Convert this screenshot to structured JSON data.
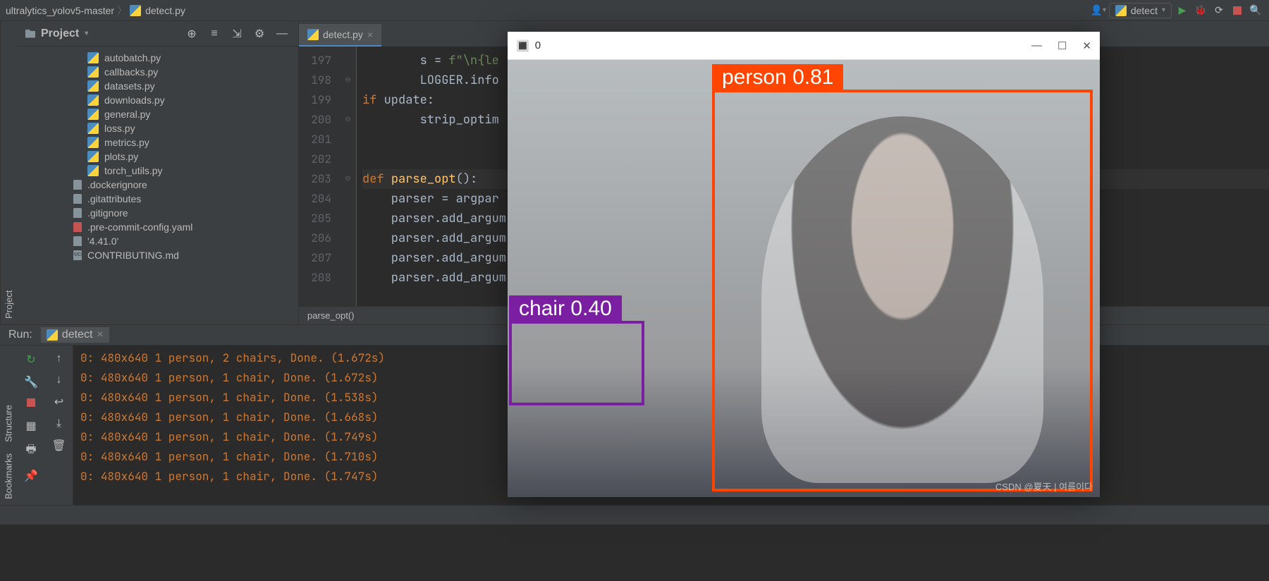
{
  "nav": {
    "breadcrumb_root": "ultralytics_yolov5-master",
    "breadcrumb_file": "detect.py",
    "run_config": "detect"
  },
  "project": {
    "title": "Project",
    "files": [
      "autobatch.py",
      "callbacks.py",
      "datasets.py",
      "downloads.py",
      "general.py",
      "loss.py",
      "metrics.py",
      "plots.py",
      "torch_utils.py",
      ".dockerignore",
      ".gitattributes",
      ".gitignore",
      ".pre-commit-config.yaml",
      "'4.41.0'",
      "CONTRIBUTING.md"
    ]
  },
  "editor": {
    "tab": "detect.py",
    "lines": [
      "197",
      "198",
      "199",
      "200",
      "201",
      "202",
      "203",
      "204",
      "205",
      "206",
      "207",
      "208"
    ],
    "breadcrumb": "parse_opt()"
  },
  "code": {
    "l197a": "        s = ",
    "l197b": "f\"\\n{le",
    "l198": "        LOGGER.info",
    "l199a": "if",
    "l199b": " update:",
    "l200a": "        ",
    "l200b": "strip_optim",
    "l203a": "def ",
    "l203b": "parse_opt",
    "l203c": "():",
    "l204": "    parser = argpar",
    "l205": "    parser.add_argum",
    "l206": "    parser.add_argum",
    "l207": "    parser.add_argum",
    "l208": "    parser.add_argum"
  },
  "run": {
    "title": "Run:",
    "tab": "detect",
    "lines": [
      "0: 480x640 1 person, 2 chairs, Done. (1.672s)",
      "0: 480x640 1 person, 1 chair, Done. (1.672s)",
      "0: 480x640 1 person, 1 chair, Done. (1.538s)",
      "0: 480x640 1 person, 1 chair, Done. (1.668s)",
      "0: 480x640 1 person, 1 chair, Done. (1.749s)",
      "0: 480x640 1 person, 1 chair, Done. (1.710s)",
      "0: 480x640 1 person, 1 chair, Done. (1.747s)"
    ]
  },
  "detection": {
    "title": "0",
    "person_label": "person 0.81",
    "chair_label": "chair 0.40",
    "watermark": "CSDN @夏天 | 여름이다"
  },
  "side_tabs": {
    "project": "Project",
    "structure": "Structure",
    "bookmarks": "Bookmarks"
  }
}
